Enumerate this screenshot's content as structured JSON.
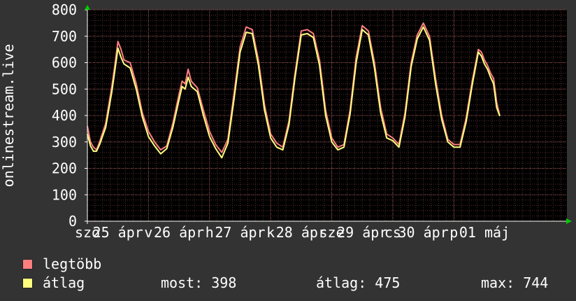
{
  "ylabel": "onlinestream.live",
  "legend": {
    "max_label": "legtöbb",
    "avg_label": "átlag",
    "max_color": "#ff7f7f",
    "avg_color": "#ffff7f"
  },
  "stats": {
    "now": "most: 398",
    "avg": "átlag: 475",
    "max": "max: 744"
  },
  "chart_data": {
    "type": "line",
    "ylabel": "onlinestream.live",
    "ylim": [
      0,
      800
    ],
    "yticks": [
      0,
      100,
      200,
      300,
      400,
      500,
      600,
      700,
      800
    ],
    "grid": true,
    "xlim": [
      0,
      7.85
    ],
    "xtick_labels": [
      {
        "x": 0.0,
        "text": "szo"
      },
      {
        "x": 0.5,
        "text": "25 ápr"
      },
      {
        "x": 1.0,
        "text": "v"
      },
      {
        "x": 1.5,
        "text": "26 ápr"
      },
      {
        "x": 2.0,
        "text": "h"
      },
      {
        "x": 2.5,
        "text": "27 ápr"
      },
      {
        "x": 3.0,
        "text": "k"
      },
      {
        "x": 3.5,
        "text": "28 ápr"
      },
      {
        "x": 4.0,
        "text": "sze"
      },
      {
        "x": 4.5,
        "text": "29 ápr"
      },
      {
        "x": 5.0,
        "text": "cs"
      },
      {
        "x": 5.5,
        "text": "30 ápr"
      },
      {
        "x": 6.0,
        "text": "p"
      },
      {
        "x": 6.5,
        "text": "01 máj"
      }
    ],
    "series": [
      {
        "name": "legtöbb",
        "x": [
          0.0,
          0.05,
          0.1,
          0.15,
          0.2,
          0.3,
          0.4,
          0.45,
          0.5,
          0.55,
          0.6,
          0.7,
          0.8,
          0.9,
          1.0,
          1.1,
          1.2,
          1.3,
          1.4,
          1.5,
          1.55,
          1.6,
          1.65,
          1.7,
          1.8,
          1.9,
          2.0,
          2.1,
          2.2,
          2.3,
          2.4,
          2.5,
          2.6,
          2.7,
          2.8,
          2.9,
          3.0,
          3.1,
          3.2,
          3.3,
          3.4,
          3.5,
          3.6,
          3.7,
          3.8,
          3.9,
          4.0,
          4.1,
          4.2,
          4.3,
          4.4,
          4.5,
          4.6,
          4.7,
          4.8,
          4.9,
          5.0,
          5.1,
          5.2,
          5.3,
          5.4,
          5.5,
          5.6,
          5.7,
          5.8,
          5.9,
          6.0,
          6.1,
          6.2,
          6.3,
          6.4,
          6.45,
          6.5,
          6.55,
          6.6,
          6.65,
          6.7,
          6.75
        ],
        "values": [
          360,
          300,
          280,
          270,
          300,
          370,
          510,
          590,
          680,
          650,
          610,
          600,
          520,
          410,
          340,
          300,
          270,
          285,
          370,
          480,
          530,
          520,
          575,
          530,
          505,
          420,
          340,
          290,
          260,
          310,
          480,
          660,
          735,
          725,
          610,
          440,
          330,
          295,
          280,
          380,
          560,
          720,
          725,
          710,
          610,
          420,
          315,
          280,
          290,
          420,
          620,
          740,
          720,
          600,
          430,
          330,
          315,
          290,
          410,
          600,
          705,
          750,
          700,
          540,
          400,
          310,
          290,
          290,
          390,
          530,
          650,
          640,
          610,
          590,
          560,
          540,
          450,
          400
        ]
      },
      {
        "name": "átlag",
        "x": [
          0.0,
          0.05,
          0.1,
          0.15,
          0.2,
          0.3,
          0.4,
          0.45,
          0.5,
          0.55,
          0.6,
          0.7,
          0.8,
          0.9,
          1.0,
          1.1,
          1.2,
          1.3,
          1.4,
          1.5,
          1.55,
          1.6,
          1.65,
          1.7,
          1.8,
          1.9,
          2.0,
          2.1,
          2.2,
          2.3,
          2.4,
          2.5,
          2.6,
          2.7,
          2.8,
          2.9,
          3.0,
          3.1,
          3.2,
          3.3,
          3.4,
          3.5,
          3.6,
          3.7,
          3.8,
          3.9,
          4.0,
          4.1,
          4.2,
          4.3,
          4.4,
          4.5,
          4.6,
          4.7,
          4.8,
          4.9,
          5.0,
          5.1,
          5.2,
          5.3,
          5.4,
          5.5,
          5.6,
          5.7,
          5.8,
          5.9,
          6.0,
          6.1,
          6.2,
          6.3,
          6.4,
          6.45,
          6.5,
          6.55,
          6.6,
          6.65,
          6.7,
          6.75
        ],
        "values": [
          330,
          285,
          265,
          265,
          290,
          355,
          490,
          570,
          655,
          620,
          595,
          580,
          500,
          395,
          320,
          285,
          255,
          275,
          355,
          460,
          510,
          500,
          545,
          510,
          490,
          400,
          320,
          275,
          240,
          295,
          460,
          640,
          715,
          710,
          590,
          420,
          315,
          280,
          270,
          365,
          545,
          705,
          710,
          695,
          590,
          400,
          300,
          270,
          280,
          405,
          600,
          725,
          705,
          580,
          410,
          315,
          305,
          280,
          395,
          585,
          690,
          735,
          685,
          520,
          385,
          300,
          280,
          280,
          375,
          515,
          640,
          625,
          595,
          575,
          545,
          520,
          430,
          398
        ]
      }
    ]
  }
}
